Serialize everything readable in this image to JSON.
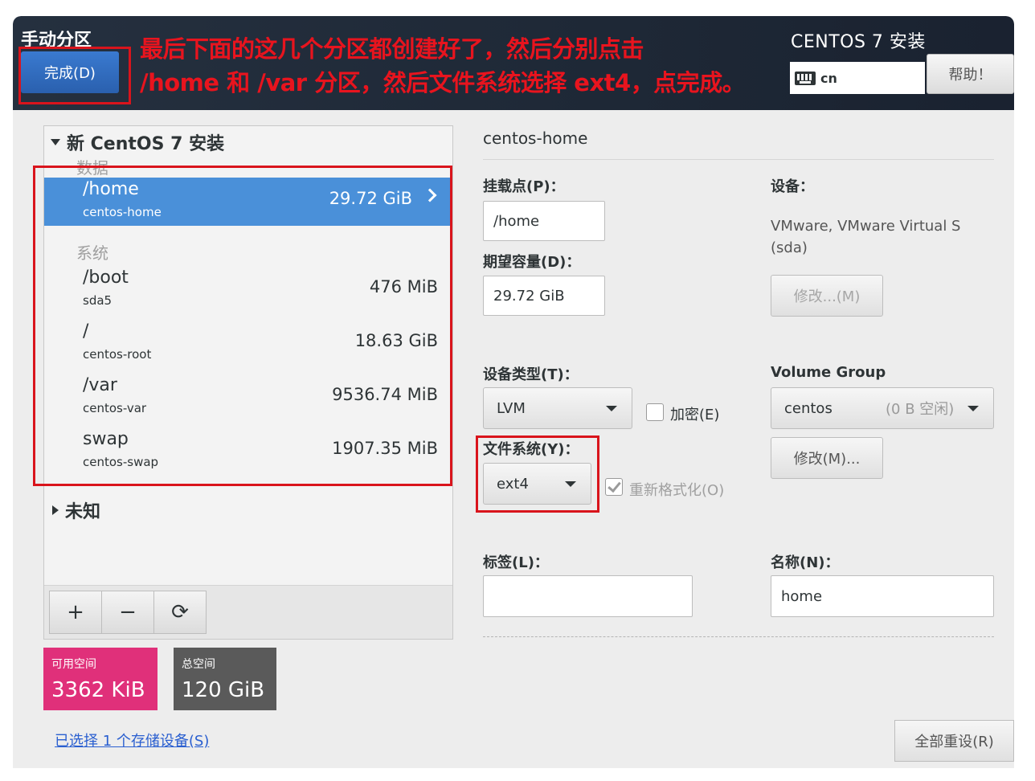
{
  "header": {
    "title": "手动分区",
    "done_label": "完成(D)",
    "annotation_line1": "最后下面的这几个分区都创建好了，然后分别点击",
    "annotation_line2": "/home 和 /var 分区，然后文件系统选择 ext4，点完成。",
    "product_title": "CENTOS 7 安装",
    "keyboard_layout": "cn",
    "help_label": "帮助！",
    "keyboard_icon": "keyboard-icon"
  },
  "partitions": {
    "install_title": "新 CentOS 7 安装",
    "data_group": "数据",
    "system_group": "系统",
    "unknown_title": "未知",
    "items": [
      {
        "mount": "/home",
        "device": "centos-home",
        "size": "29.72 GiB"
      },
      {
        "mount": "/boot",
        "device": "sda5",
        "size": "476 MiB"
      },
      {
        "mount": "/",
        "device": "centos-root",
        "size": "18.63 GiB"
      },
      {
        "mount": "/var",
        "device": "centos-var",
        "size": "9536.74 MiB"
      },
      {
        "mount": "swap",
        "device": "centos-swap",
        "size": "1907.35 MiB"
      }
    ],
    "toolbar": {
      "add": "+",
      "remove": "−",
      "refresh": "⟳"
    }
  },
  "space": {
    "available_label": "可用空间",
    "available_value": "3362 KiB",
    "total_label": "总空间",
    "total_value": "120 GiB",
    "available_color": "#e0307a",
    "total_color": "#5a5a5a"
  },
  "storage_link": "已选择 1 个存储设备(S)",
  "detail": {
    "title": "centos-home",
    "mount_label": "挂载点(P)：",
    "mount_value": "/home",
    "capacity_label": "期望容量(D)：",
    "capacity_value": "29.72 GiB",
    "device_label": "设备：",
    "device_value": "VMware, VMware Virtual S (sda)",
    "modify_disabled_label": "修改...(M)",
    "device_type_label": "设备类型(T)：",
    "device_type_value": "LVM",
    "encrypt_label": "加密(E)",
    "volume_group_label": "Volume Group",
    "volume_group_value": "centos",
    "volume_group_free": "(0 B 空闲)",
    "modify_label": "修改(M)...",
    "filesystem_label": "文件系统(Y)：",
    "filesystem_value": "ext4",
    "reformat_label": "重新格式化(O)",
    "tag_label": "标签(L)：",
    "tag_value": "",
    "name_label": "名称(N)：",
    "name_value": "home"
  },
  "reset_label": "全部重设(R)",
  "colors": {
    "accent_selected": "#4a90d9",
    "annotation_red": "#e8141e",
    "header_bg": "#25303f"
  }
}
